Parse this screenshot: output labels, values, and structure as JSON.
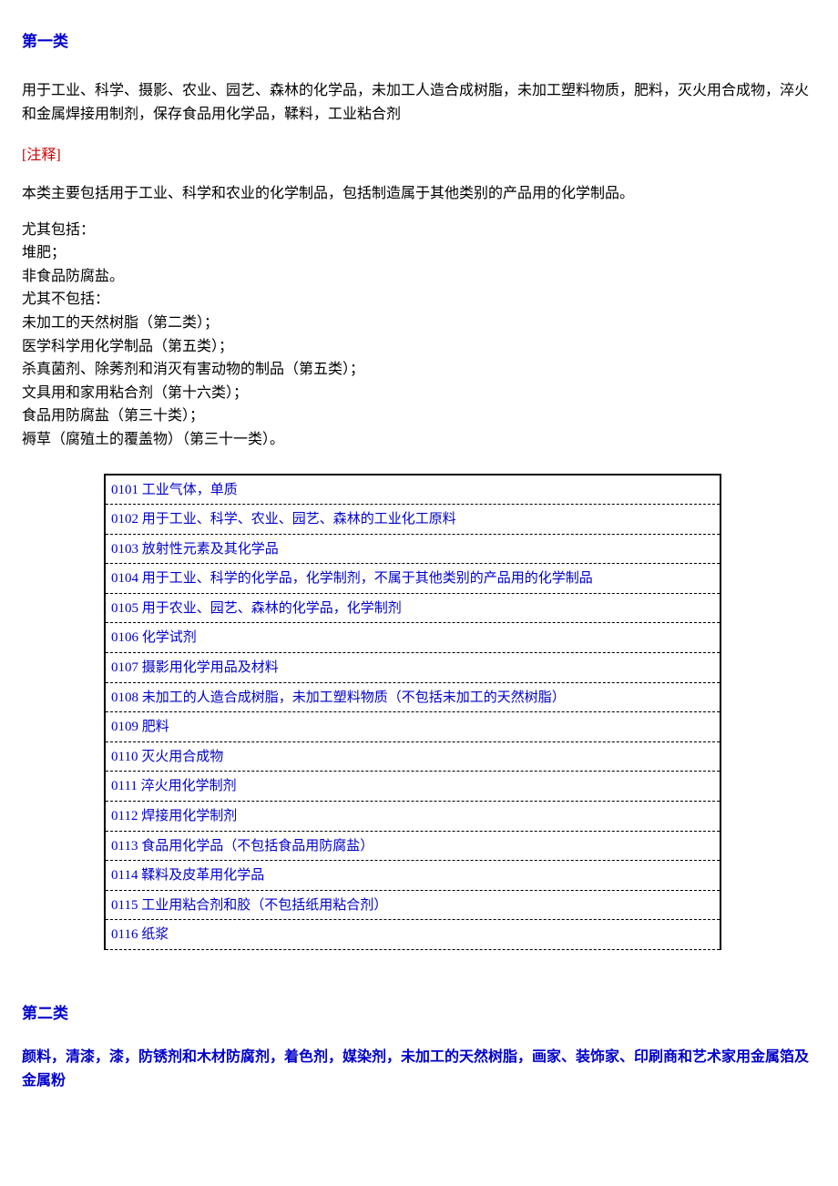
{
  "section1": {
    "title": "第一类",
    "description": "用于工业、科学、摄影、农业、园艺、森林的化学品，未加工人造合成树脂，未加工塑料物质，肥料，灭火用合成物，淬火和金属焊接用制剂，保存食品用化学品，鞣料，工业粘合剂",
    "annotation_label": "[注释]",
    "note_text": "本类主要包括用于工业、科学和农业的化学制品，包括制造属于其他类别的产品用的化学制品。",
    "includes_header": "尤其包括：",
    "includes": [
      "堆肥；",
      "非食品防腐盐。"
    ],
    "excludes_header": "尤其不包括：",
    "excludes": [
      "未加工的天然树脂（第二类）；",
      "医学科学用化学制品（第五类）；",
      "杀真菌剂、除莠剂和消灭有害动物的制品（第五类）；",
      "文具用和家用粘合剂（第十六类）；",
      "食品用防腐盐（第三十类）；",
      "褥草（腐殖土的覆盖物）（第三十一类）。"
    ],
    "table": [
      {
        "code": "0101",
        "text": "工业气体，单质"
      },
      {
        "code": "0102",
        "text": "用于工业、科学、农业、园艺、森林的工业化工原料"
      },
      {
        "code": "0103",
        "text": "放射性元素及其化学品"
      },
      {
        "code": "0104",
        "text": "用于工业、科学的化学品，化学制剂，不属于其他类别的产品用的化学制品"
      },
      {
        "code": "0105",
        "text": "用于农业、园艺、森林的化学品，化学制剂"
      },
      {
        "code": "0106",
        "text": "化学试剂"
      },
      {
        "code": "0107",
        "text": "摄影用化学用品及材料"
      },
      {
        "code": "0108",
        "text": "未加工的人造合成树脂，未加工塑料物质（不包括未加工的天然树脂）"
      },
      {
        "code": "0109",
        "text": "肥料"
      },
      {
        "code": "0110",
        "text": "灭火用合成物"
      },
      {
        "code": "0111",
        "text": "淬火用化学制剂"
      },
      {
        "code": "0112",
        "text": "焊接用化学制剂"
      },
      {
        "code": "0113",
        "text": "食品用化学品（不包括食品用防腐盐）"
      },
      {
        "code": "0114",
        "text": "鞣料及皮革用化学品"
      },
      {
        "code": "0115",
        "text": "工业用粘合剂和胶（不包括纸用粘合剂）"
      },
      {
        "code": "0116",
        "text": "纸浆"
      }
    ]
  },
  "section2": {
    "title": "第二类",
    "description": "颜料，清漆，漆，防锈剂和木材防腐剂，着色剂，媒染剂，未加工的天然树脂，画家、装饰家、印刷商和艺术家用金属箔及金属粉"
  }
}
